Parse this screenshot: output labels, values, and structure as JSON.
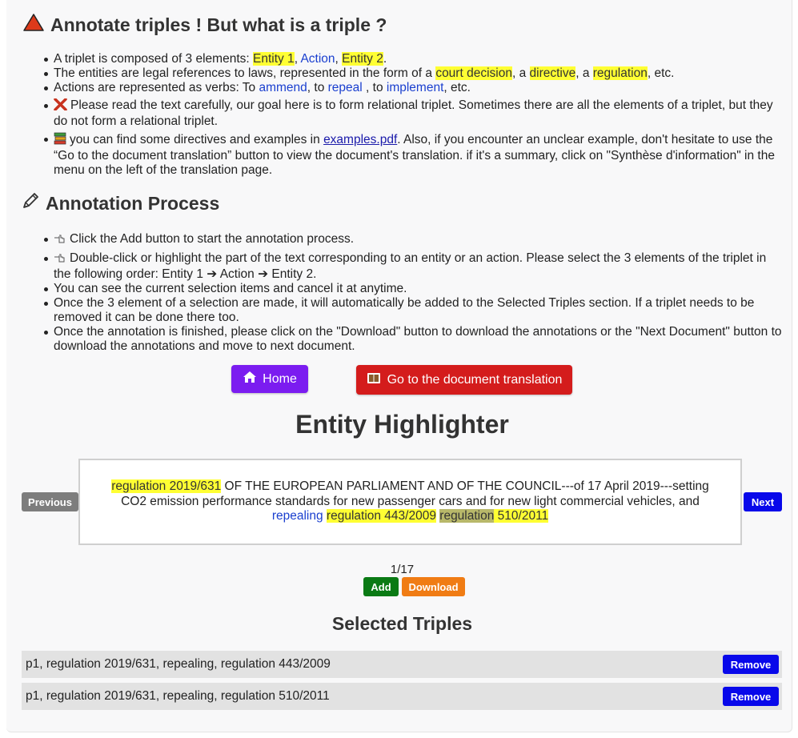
{
  "intro": {
    "title": "Annotate triples ! But what is a triple ?",
    "items": {
      "i1_pre": "A triplet is composed of 3 elements: ",
      "i1_e1": "Entity 1",
      "i1_sep1": ", ",
      "i1_act": "Action",
      "i1_sep2": ", ",
      "i1_e2": "Entity 2",
      "i1_end": ".",
      "i2_pre": "The entities are legal references to laws, represented in the form of a ",
      "i2_h1": "court decision",
      "i2_sep1": ", a ",
      "i2_h2": "directive",
      "i2_sep2": ", a ",
      "i2_h3": "regulation",
      "i2_end": ", etc.",
      "i3_pre": "Actions are represented as verbs: To ",
      "i3_a1": "ammend",
      "i3_sep1": ", to ",
      "i3_a2": "repeal",
      "i3_sep2": " , to ",
      "i3_a3": "implement",
      "i3_end": ", etc.",
      "i4_text": "Please read the text carefully, our goal here is to form relational triplet. Sometimes there are all the elements of a triplet, but they do not form a relational triplet.",
      "i5_pre": "you can find some directives and examples in ",
      "i5_link": "examples.pdf",
      "i5_post": ". Also, if you encounter an unclear example, don't hesitate to use the “Go to the document translation” button to view the document's translation. if it's a summary, click on \"Synthèse d'information\" in the menu on the left of the translation page."
    }
  },
  "process": {
    "title": "Annotation Process",
    "items": {
      "p1": "Click the Add button to start the annotation process.",
      "p2": "Double-click or highlight the part of the text corresponding to an entity or an action. Please select the 3 elements of the triplet in the following order: Entity 1 ➔ Action ➔ Entity 2.",
      "p3": "You can see the current selection items and cancel it at anytime.",
      "p4": "Once the 3 element of a selection are made, it will automatically be added to the Selected Triples section. If a triplet needs to be removed it can be done there too.",
      "p5": "Once the annotation is finished, please click on the \"Download\" button to download the annotations or the \"Next Document\" button to download the annotations and move to next document."
    }
  },
  "nav": {
    "home_label": "Home",
    "translation_label": "Go to the document translation"
  },
  "highlighter": {
    "title": "Entity Highlighter",
    "t_e1": "regulation 2019/631",
    "t_mid": " OF THE EUROPEAN PARLIAMENT AND OF THE COUNCIL---of 17 April 2019---setting CO2 emission performance standards for new passenger cars and for new light commercial vehicles, and ",
    "t_act": "repealing",
    "t_sp": " ",
    "t_e2": "regulation 443/2009",
    "t_sp2": " ",
    "t_e3a": "regulation",
    "t_sp3": " ",
    "t_e3b": "510/2011",
    "prev_label": "Previous",
    "next_label": "Next",
    "pager": "1/17",
    "add_label": "Add",
    "download_label": "Download"
  },
  "selected": {
    "title": "Selected Triples",
    "rows": [
      {
        "text": "p1, regulation 2019/631, repealing, regulation 443/2009",
        "remove_label": "Remove"
      },
      {
        "text": "p1, regulation 2019/631, repealing, regulation 510/2011",
        "remove_label": "Remove"
      }
    ]
  },
  "colors": {
    "highlight": "#ffff33",
    "action": "#1a3fcf",
    "home_button": "#7b1cf0",
    "translation_button": "#d41c1c",
    "primary_button": "#0808ea",
    "add_button": "#0a7a14",
    "download_button": "#f07c14",
    "previous_button": "#7d7d7d"
  },
  "icons": {
    "warning": "red-triangle-icon",
    "pencil": "pencil-icon",
    "cross": "red-cross-icon",
    "books": "books-icon",
    "hand": "pointing-hand-icon",
    "house": "house-icon",
    "book": "open-book-icon"
  }
}
